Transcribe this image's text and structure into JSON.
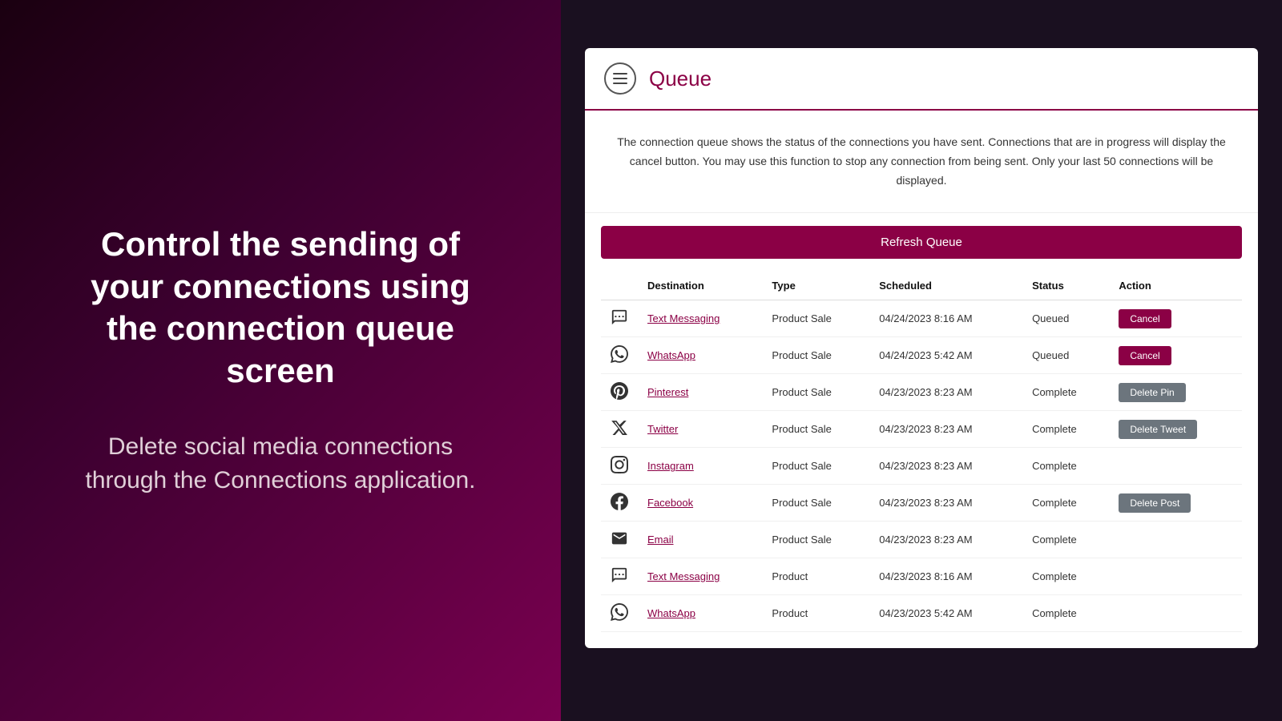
{
  "left": {
    "headline": "Control the sending of your connections using the connection queue screen",
    "subtext": "Delete social media connections through the Connections application."
  },
  "right": {
    "header": {
      "icon_label": "menu-icon",
      "title": "Queue"
    },
    "description": "The connection queue shows the status of the connections you have sent. Connections that are in progress will display the cancel button. You may use this function to stop any connection from being sent. Only your last 50 connections will be displayed.",
    "refresh_button": "Refresh Queue",
    "table": {
      "columns": [
        "Destination",
        "Type",
        "Scheduled",
        "Status",
        "Action"
      ],
      "rows": [
        {
          "icon": "sms",
          "destination": "Text Messaging",
          "type": "Product Sale",
          "scheduled": "04/24/2023 8:16 AM",
          "status": "Queued",
          "status_class": "queued",
          "action": "Cancel",
          "action_class": "cancel"
        },
        {
          "icon": "whatsapp",
          "destination": "WhatsApp",
          "type": "Product Sale",
          "scheduled": "04/24/2023 5:42 AM",
          "status": "Queued",
          "status_class": "queued",
          "action": "Cancel",
          "action_class": "cancel"
        },
        {
          "icon": "pinterest",
          "destination": "Pinterest",
          "type": "Product Sale",
          "scheduled": "04/23/2023 8:23 AM",
          "status": "Complete",
          "status_class": "complete",
          "action": "Delete Pin",
          "action_class": "delete-pin"
        },
        {
          "icon": "twitter",
          "destination": "Twitter",
          "type": "Product Sale",
          "scheduled": "04/23/2023 8:23 AM",
          "status": "Complete",
          "status_class": "complete",
          "action": "Delete Tweet",
          "action_class": "delete-tweet"
        },
        {
          "icon": "instagram",
          "destination": "Instagram",
          "type": "Product Sale",
          "scheduled": "04/23/2023 8:23 AM",
          "status": "Complete",
          "status_class": "complete",
          "action": "",
          "action_class": ""
        },
        {
          "icon": "facebook",
          "destination": "Facebook",
          "type": "Product Sale",
          "scheduled": "04/23/2023 8:23 AM",
          "status": "Complete",
          "status_class": "complete",
          "action": "Delete Post",
          "action_class": "delete-post"
        },
        {
          "icon": "email",
          "destination": "Email",
          "type": "Product Sale",
          "scheduled": "04/23/2023 8:23 AM",
          "status": "Complete",
          "status_class": "complete",
          "action": "",
          "action_class": ""
        },
        {
          "icon": "sms",
          "destination": "Text Messaging",
          "type": "Product",
          "scheduled": "04/23/2023 8:16 AM",
          "status": "Complete",
          "status_class": "complete",
          "action": "",
          "action_class": ""
        },
        {
          "icon": "whatsapp",
          "destination": "WhatsApp",
          "type": "Product",
          "scheduled": "04/23/2023 5:42 AM",
          "status": "Complete",
          "status_class": "complete",
          "action": "",
          "action_class": ""
        }
      ]
    }
  }
}
